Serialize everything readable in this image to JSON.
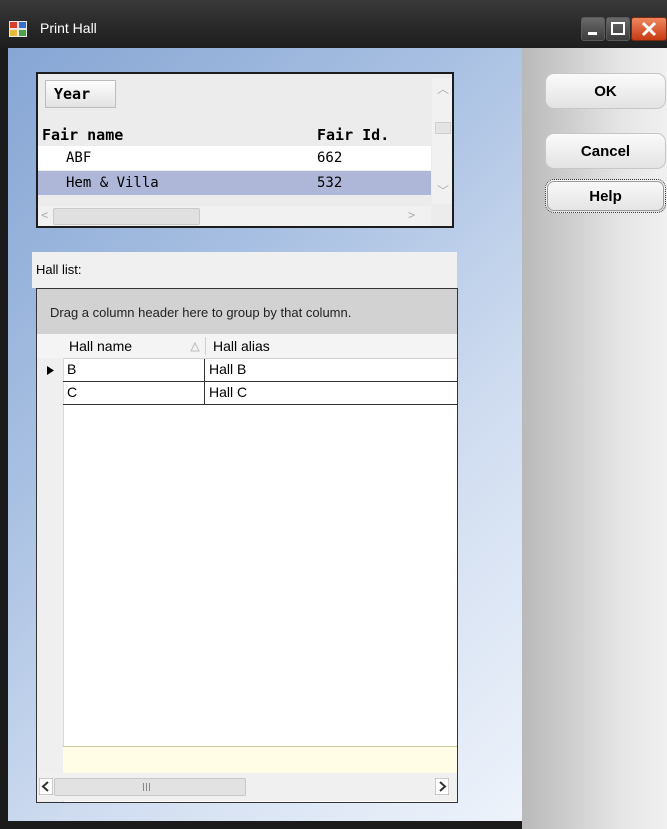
{
  "window": {
    "title": "Print Hall"
  },
  "fair_grid": {
    "year_button": "Year",
    "columns": [
      "Fair name",
      "Fair Id."
    ],
    "rows": [
      {
        "name": "ABF",
        "id": "662"
      },
      {
        "name": "Hem & Villa",
        "id": "532"
      }
    ],
    "selected_row": 1
  },
  "hall_list": {
    "label": "Hall list:",
    "group_panel_text": "Drag a column header here to group by that column.",
    "columns": [
      "Hall name",
      "Hall alias"
    ],
    "rows": [
      {
        "name": "B",
        "alias": "Hall B"
      },
      {
        "name": "C",
        "alias": "Hall C"
      }
    ],
    "current_row": 0
  },
  "buttons": {
    "ok": "OK",
    "cancel": "Cancel",
    "help": "Help"
  }
}
